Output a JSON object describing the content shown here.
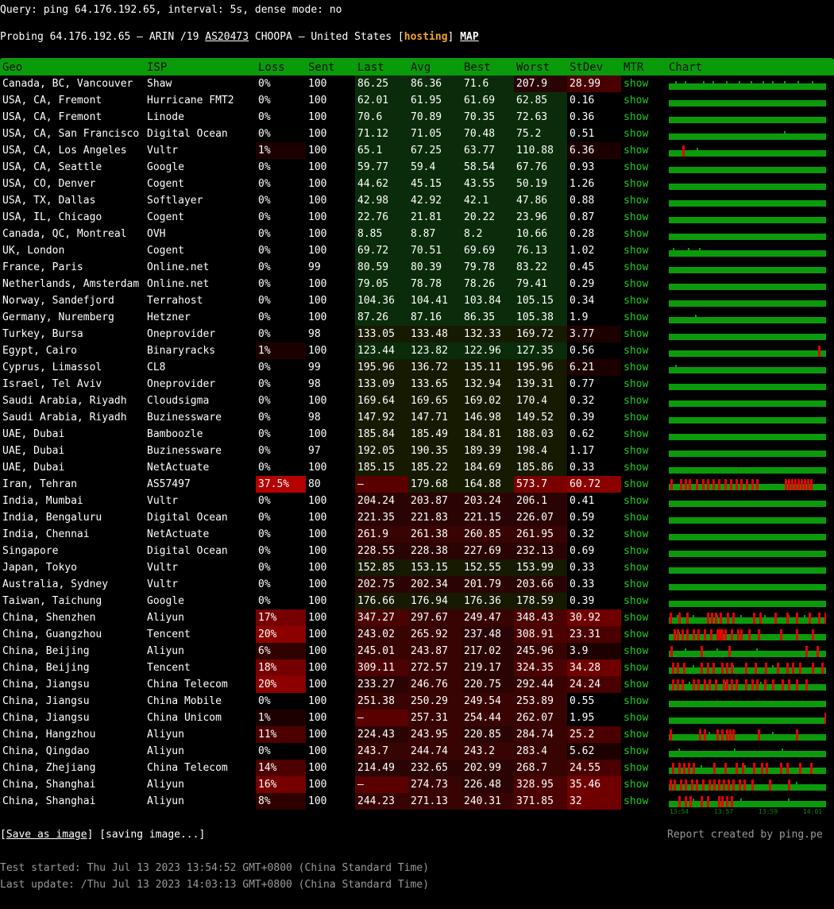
{
  "query_line": "Query: ping 64.176.192.65, interval: 5s, dense mode: no",
  "probe": {
    "prefix": "Probing 64.176.192.65 — ARIN /19 ",
    "as": "AS20473",
    "middle": " CHOOPA — United States [",
    "hosting": "hosting",
    "close": "]",
    "map": "MAP"
  },
  "colors": {
    "header_green": "#0a9b0a",
    "mtr_green": "#22cc22",
    "chart_green": "#0b9a0b",
    "loss_red": "#e60000",
    "hosting_orange": "#f0a52a"
  },
  "table": {
    "headers": [
      "Geo",
      "ISP",
      "Loss",
      "Sent",
      "Last",
      "Avg",
      "Best",
      "Worst",
      "StDev",
      "MTR",
      "Chart"
    ],
    "mtr_label": "show",
    "rows": [
      {
        "geo": "Canada, BC, Vancouver",
        "isp": "Shaw",
        "loss": "0%",
        "sent": "100",
        "last": "86.25",
        "avg": "86.36",
        "best": "71.6",
        "worst": "207.9",
        "stdev": "28.99",
        "spikes": [
          8,
          20,
          43,
          55,
          72,
          88,
          103,
          118,
          130,
          145,
          162,
          180
        ],
        "loss_marks": []
      },
      {
        "geo": "USA, CA, Fremont",
        "isp": "Hurricane FMT2",
        "loss": "0%",
        "sent": "100",
        "last": "62.01",
        "avg": "61.95",
        "best": "61.69",
        "worst": "62.85",
        "stdev": "0.16",
        "spikes": [],
        "loss_marks": []
      },
      {
        "geo": "USA, CA, Fremont",
        "isp": "Linode",
        "loss": "0%",
        "sent": "100",
        "last": "70.6",
        "avg": "70.89",
        "best": "70.35",
        "worst": "72.63",
        "stdev": "0.36",
        "spikes": [],
        "loss_marks": []
      },
      {
        "geo": "USA, CA, San Francisco",
        "isp": "Digital Ocean",
        "loss": "0%",
        "sent": "100",
        "last": "71.12",
        "avg": "71.05",
        "best": "70.48",
        "worst": "75.2",
        "stdev": "0.51",
        "spikes": [
          145
        ],
        "loss_marks": []
      },
      {
        "geo": "USA, CA, Los Angeles",
        "isp": "Vultr",
        "loss": "1%",
        "sent": "100",
        "last": "65.1",
        "avg": "67.25",
        "best": "63.77",
        "worst": "110.88",
        "stdev": "6.36",
        "spikes": [
          35
        ],
        "loss_marks": [
          17
        ]
      },
      {
        "geo": "USA, CA, Seattle",
        "isp": "Google",
        "loss": "0%",
        "sent": "100",
        "last": "59.77",
        "avg": "59.4",
        "best": "58.54",
        "worst": "67.76",
        "stdev": "0.93",
        "spikes": [],
        "loss_marks": []
      },
      {
        "geo": "USA, CO, Denver",
        "isp": "Cogent",
        "loss": "0%",
        "sent": "100",
        "last": "44.62",
        "avg": "45.15",
        "best": "43.55",
        "worst": "50.19",
        "stdev": "1.26",
        "spikes": [],
        "loss_marks": []
      },
      {
        "geo": "USA, TX, Dallas",
        "isp": "Softlayer",
        "loss": "0%",
        "sent": "100",
        "last": "42.98",
        "avg": "42.92",
        "best": "42.1",
        "worst": "47.86",
        "stdev": "0.88",
        "spikes": [],
        "loss_marks": []
      },
      {
        "geo": "USA, IL, Chicago",
        "isp": "Cogent",
        "loss": "0%",
        "sent": "100",
        "last": "22.76",
        "avg": "21.81",
        "best": "20.22",
        "worst": "23.96",
        "stdev": "0.87",
        "spikes": [],
        "loss_marks": []
      },
      {
        "geo": "Canada, QC, Montreal",
        "isp": "OVH",
        "loss": "0%",
        "sent": "100",
        "last": "8.85",
        "avg": "8.87",
        "best": "8.2",
        "worst": "10.66",
        "stdev": "0.28",
        "spikes": [],
        "loss_marks": []
      },
      {
        "geo": "UK, London",
        "isp": "Cogent",
        "loss": "0%",
        "sent": "100",
        "last": "69.72",
        "avg": "70.51",
        "best": "69.69",
        "worst": "76.13",
        "stdev": "1.02",
        "spikes": [
          5,
          24,
          38
        ],
        "loss_marks": []
      },
      {
        "geo": "France, Paris",
        "isp": "Online.net",
        "loss": "0%",
        "sent": "99",
        "last": "80.59",
        "avg": "80.39",
        "best": "79.78",
        "worst": "83.22",
        "stdev": "0.45",
        "spikes": [],
        "loss_marks": []
      },
      {
        "geo": "Netherlands, Amsterdam",
        "isp": "Online.net",
        "loss": "0%",
        "sent": "100",
        "last": "79.05",
        "avg": "78.78",
        "best": "78.26",
        "worst": "79.41",
        "stdev": "0.29",
        "spikes": [],
        "loss_marks": []
      },
      {
        "geo": "Norway, Sandefjord",
        "isp": "Terrahost",
        "loss": "0%",
        "sent": "100",
        "last": "104.36",
        "avg": "104.41",
        "best": "103.84",
        "worst": "105.15",
        "stdev": "0.34",
        "spikes": [],
        "loss_marks": []
      },
      {
        "geo": "Germany, Nuremberg",
        "isp": "Hetzner",
        "loss": "0%",
        "sent": "100",
        "last": "87.26",
        "avg": "87.16",
        "best": "86.35",
        "worst": "105.38",
        "stdev": "1.9",
        "spikes": [
          33
        ],
        "loss_marks": []
      },
      {
        "geo": "Turkey, Bursa",
        "isp": "Oneprovider",
        "loss": "0%",
        "sent": "98",
        "last": "133.05",
        "avg": "133.48",
        "best": "132.33",
        "worst": "169.72",
        "stdev": "3.77",
        "spikes": [],
        "loss_marks": []
      },
      {
        "geo": "Egypt, Cairo",
        "isp": "Binaryracks",
        "loss": "1%",
        "sent": "100",
        "last": "123.44",
        "avg": "123.82",
        "best": "122.96",
        "worst": "127.35",
        "stdev": "0.56",
        "spikes": [],
        "loss_marks": [
          188
        ]
      },
      {
        "geo": "Cyprus, Limassol",
        "isp": "CL8",
        "loss": "0%",
        "sent": "99",
        "last": "195.96",
        "avg": "136.72",
        "best": "135.11",
        "worst": "195.96",
        "stdev": "6.21",
        "spikes": [
          8
        ],
        "loss_marks": []
      },
      {
        "geo": "Israel, Tel Aviv",
        "isp": "Oneprovider",
        "loss": "0%",
        "sent": "98",
        "last": "133.09",
        "avg": "133.65",
        "best": "132.94",
        "worst": "139.31",
        "stdev": "0.77",
        "spikes": [],
        "loss_marks": []
      },
      {
        "geo": "Saudi Arabia, Riyadh",
        "isp": "Cloudsigma",
        "loss": "0%",
        "sent": "100",
        "last": "169.64",
        "avg": "169.65",
        "best": "169.02",
        "worst": "170.4",
        "stdev": "0.32",
        "spikes": [],
        "loss_marks": []
      },
      {
        "geo": "Saudi Arabia, Riyadh",
        "isp": "Buzinessware",
        "loss": "0%",
        "sent": "98",
        "last": "147.92",
        "avg": "147.71",
        "best": "146.98",
        "worst": "149.52",
        "stdev": "0.39",
        "spikes": [],
        "loss_marks": []
      },
      {
        "geo": "UAE, Dubai",
        "isp": "Bamboozle",
        "loss": "0%",
        "sent": "100",
        "last": "185.84",
        "avg": "185.49",
        "best": "184.81",
        "worst": "188.03",
        "stdev": "0.62",
        "spikes": [],
        "loss_marks": []
      },
      {
        "geo": "UAE, Dubai",
        "isp": "Buzinessware",
        "loss": "0%",
        "sent": "97",
        "last": "192.05",
        "avg": "190.35",
        "best": "189.39",
        "worst": "198.4",
        "stdev": "1.17",
        "spikes": [],
        "loss_marks": []
      },
      {
        "geo": "UAE, Dubai",
        "isp": "NetActuate",
        "loss": "0%",
        "sent": "100",
        "last": "185.15",
        "avg": "185.22",
        "best": "184.69",
        "worst": "185.86",
        "stdev": "0.33",
        "spikes": [],
        "loss_marks": []
      },
      {
        "geo": "Iran, Tehran",
        "isp": "AS57497",
        "loss": "37.5%",
        "sent": "80",
        "last": "—",
        "avg": "179.68",
        "best": "164.88",
        "worst": "573.7",
        "stdev": "60.72",
        "spikes": [],
        "loss_marks": [
          2,
          14,
          20,
          25,
          34,
          42,
          48,
          55,
          62,
          70,
          77,
          84,
          90,
          97,
          104,
          110,
          146,
          150,
          154,
          158,
          162,
          166,
          170,
          174,
          178
        ]
      },
      {
        "geo": "India, Mumbai",
        "isp": "Vultr",
        "loss": "0%",
        "sent": "100",
        "last": "204.24",
        "avg": "203.87",
        "best": "203.24",
        "worst": "206.1",
        "stdev": "0.41",
        "spikes": [],
        "loss_marks": []
      },
      {
        "geo": "India, Bengaluru",
        "isp": "Digital Ocean",
        "loss": "0%",
        "sent": "100",
        "last": "221.35",
        "avg": "221.83",
        "best": "221.15",
        "worst": "226.07",
        "stdev": "0.59",
        "spikes": [],
        "loss_marks": []
      },
      {
        "geo": "India, Chennai",
        "isp": "NetActuate",
        "loss": "0%",
        "sent": "100",
        "last": "261.9",
        "avg": "261.38",
        "best": "260.85",
        "worst": "261.95",
        "stdev": "0.32",
        "spikes": [],
        "loss_marks": []
      },
      {
        "geo": "Singapore",
        "isp": "Digital Ocean",
        "loss": "0%",
        "sent": "100",
        "last": "228.55",
        "avg": "228.38",
        "best": "227.69",
        "worst": "232.13",
        "stdev": "0.69",
        "spikes": [],
        "loss_marks": []
      },
      {
        "geo": "Japan, Tokyo",
        "isp": "Vultr",
        "loss": "0%",
        "sent": "100",
        "last": "152.85",
        "avg": "153.15",
        "best": "152.55",
        "worst": "153.99",
        "stdev": "0.33",
        "spikes": [],
        "loss_marks": []
      },
      {
        "geo": "Australia, Sydney",
        "isp": "Vultr",
        "loss": "0%",
        "sent": "100",
        "last": "202.75",
        "avg": "202.34",
        "best": "201.79",
        "worst": "203.66",
        "stdev": "0.33",
        "spikes": [],
        "loss_marks": []
      },
      {
        "geo": "Taiwan, Taichung",
        "isp": "Google",
        "loss": "0%",
        "sent": "100",
        "last": "176.66",
        "avg": "176.94",
        "best": "176.36",
        "worst": "178.59",
        "stdev": "0.39",
        "spikes": [],
        "loss_marks": []
      },
      {
        "geo": "China, Shenzhen",
        "isp": "Aliyun",
        "loss": "17%",
        "sent": "100",
        "last": "347.27",
        "avg": "297.67",
        "best": "249.47",
        "worst": "348.43",
        "stdev": "30.92",
        "spikes": [
          10,
          30,
          60,
          90,
          120,
          150,
          170
        ],
        "loss_marks": [
          1,
          12,
          22,
          48,
          53,
          58,
          64,
          73,
          80,
          106,
          114,
          133,
          148,
          160,
          176,
          188,
          196
        ]
      },
      {
        "geo": "China, Guangzhou",
        "isp": "Tencent",
        "loss": "20%",
        "sent": "100",
        "last": "243.02",
        "avg": "265.92",
        "best": "237.48",
        "worst": "308.91",
        "stdev": "23.31",
        "spikes": [
          12,
          45,
          100,
          140
        ],
        "loss_marks": [
          6,
          10,
          16,
          22,
          30,
          36,
          44,
          52,
          60,
          62,
          64,
          66,
          70,
          78,
          86,
          90,
          100,
          112,
          140,
          160,
          180
        ]
      },
      {
        "geo": "China, Beijing",
        "isp": "Aliyun",
        "loss": "6%",
        "sent": "100",
        "last": "245.01",
        "avg": "243.87",
        "best": "217.02",
        "worst": "245.96",
        "stdev": "3.9",
        "spikes": [
          20,
          60,
          110
        ],
        "loss_marks": [
          2,
          40,
          75,
          172,
          186
        ]
      },
      {
        "geo": "China, Beijing",
        "isp": "Tencent",
        "loss": "18%",
        "sent": "100",
        "last": "309.11",
        "avg": "272.57",
        "best": "219.17",
        "worst": "324.35",
        "stdev": "34.28",
        "spikes": [
          30,
          80,
          130
        ],
        "loss_marks": [
          4,
          10,
          18,
          40,
          48,
          55,
          66,
          72,
          78,
          96,
          108,
          121,
          136,
          148,
          155,
          164,
          180,
          192
        ]
      },
      {
        "geo": "China, Jiangsu",
        "isp": "China Telecom",
        "loss": "20%",
        "sent": "100",
        "last": "233.27",
        "avg": "246.76",
        "best": "220.75",
        "worst": "292.44",
        "stdev": "24.24",
        "spikes": [
          25,
          70,
          115
        ],
        "loss_marks": [
          4,
          10,
          16,
          30,
          36,
          44,
          50,
          58,
          68,
          72,
          78,
          84,
          96,
          104,
          110,
          120,
          130,
          142,
          150,
          160,
          172
        ]
      },
      {
        "geo": "China, Jiangsu",
        "isp": "China Mobile",
        "loss": "0%",
        "sent": "100",
        "last": "251.38",
        "avg": "250.29",
        "best": "249.54",
        "worst": "253.89",
        "stdev": "0.55",
        "spikes": [],
        "loss_marks": []
      },
      {
        "geo": "China, Jiangsu",
        "isp": "China Unicom",
        "loss": "1%",
        "sent": "100",
        "last": "—",
        "avg": "257.31",
        "best": "254.44",
        "worst": "262.07",
        "stdev": "1.95",
        "spikes": [],
        "loss_marks": [
          196
        ]
      },
      {
        "geo": "China, Hangzhou",
        "isp": "Aliyun",
        "loss": "11%",
        "sent": "100",
        "last": "224.43",
        "avg": "243.95",
        "best": "220.85",
        "worst": "284.74",
        "stdev": "25.2",
        "spikes": [
          50,
          130
        ],
        "loss_marks": [
          1,
          38,
          44,
          60,
          66,
          72,
          76,
          80,
          112,
          160
        ]
      },
      {
        "geo": "China, Qingdao",
        "isp": "Aliyun",
        "loss": "0%",
        "sent": "100",
        "last": "243.7",
        "avg": "244.74",
        "best": "243.2",
        "worst": "283.4",
        "stdev": "5.62",
        "spikes": [
          12,
          82,
          142
        ],
        "loss_marks": []
      },
      {
        "geo": "China, Zhejiang",
        "isp": "China Telecom",
        "loss": "14%",
        "sent": "100",
        "last": "214.49",
        "avg": "232.65",
        "best": "202.99",
        "worst": "268.7",
        "stdev": "24.55",
        "spikes": [
          40,
          95
        ],
        "loss_marks": [
          4,
          12,
          18,
          24,
          30,
          56,
          70,
          84,
          92,
          106,
          116,
          122,
          140,
          148,
          164,
          178
        ]
      },
      {
        "geo": "China, Shanghai",
        "isp": "Aliyun",
        "loss": "16%",
        "sent": "100",
        "last": "—",
        "avg": "274.73",
        "best": "226.48",
        "worst": "328.95",
        "stdev": "35.46",
        "spikes": [
          50,
          95,
          160
        ],
        "loss_marks": [
          1,
          6,
          14,
          20,
          28,
          34,
          42,
          50,
          56,
          62,
          68,
          74,
          80,
          88,
          94,
          104,
          126,
          150
        ]
      },
      {
        "geo": "China, Shanghai",
        "isp": "Aliyun",
        "loss": "8%",
        "sent": "100",
        "last": "244.23",
        "avg": "271.13",
        "best": "240.31",
        "worst": "371.85",
        "stdev": "32",
        "spikes": [
          30,
          90,
          150
        ],
        "loss_marks": [
          12,
          20,
          26,
          40,
          48,
          62,
          66,
          72,
          78
        ]
      }
    ]
  },
  "chart_axis": [
    "13:54",
    "13:57",
    "13:59",
    "14:01"
  ],
  "footer": {
    "save_open": "[",
    "save_link": "Save as image",
    "save_close": "] [saving image...]",
    "credit": "Report created by ping.pe",
    "test_started": "Test started: Thu Jul 13 2023 13:54:52 GMT+0800 (China Standard Time)",
    "last_update": "Last update: /Thu Jul 13 2023 14:03:13 GMT+0800 (China Standard Time)"
  }
}
